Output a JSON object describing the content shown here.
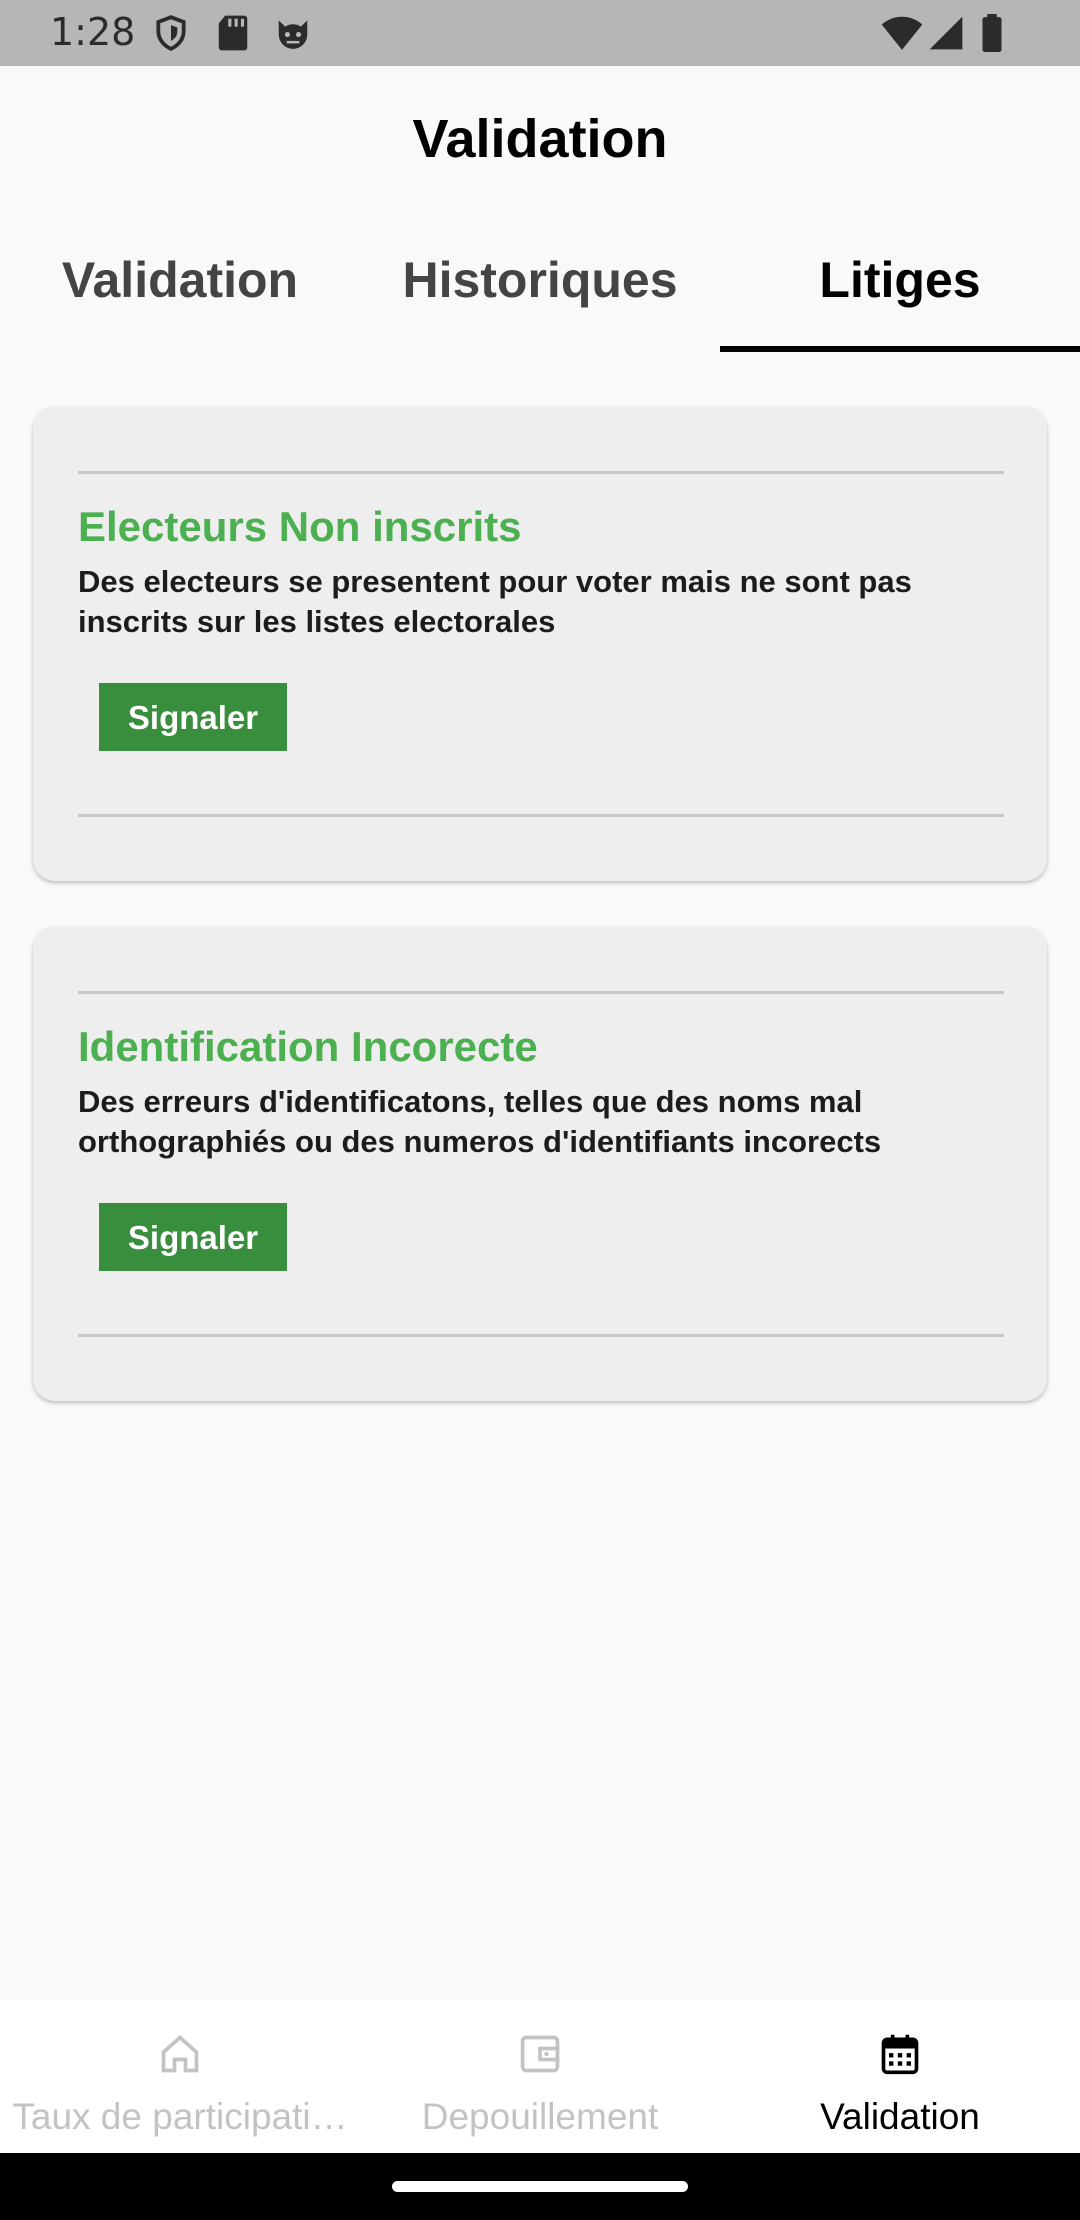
{
  "status_bar": {
    "time": "1:28",
    "left_icons": [
      "shield-icon",
      "sd-card-icon",
      "cat-face-icon"
    ],
    "right_icons": [
      "wifi-icon",
      "signal-icon",
      "battery-icon"
    ]
  },
  "header": {
    "title": "Validation"
  },
  "tabs": [
    {
      "label": "Validation",
      "active": false
    },
    {
      "label": "Historiques",
      "active": false
    },
    {
      "label": "Litiges",
      "active": true
    }
  ],
  "cards": [
    {
      "title": "Electeurs Non inscrits",
      "description": "Des electeurs se presentent pour voter mais ne sont pas inscrits sur les listes electorales",
      "button_label": "Signaler"
    },
    {
      "title": "Identification Incorecte",
      "description": "Des erreurs d'identificatons, telles que des noms mal orthographiés ou des numeros d'identifiants incorects",
      "button_label": "Signaler"
    }
  ],
  "bottom_nav": [
    {
      "label": "Taux de participati…",
      "icon": "home-icon",
      "active": false
    },
    {
      "label": "Depouillement",
      "icon": "wallet-icon",
      "active": false
    },
    {
      "label": "Validation",
      "icon": "calendar-icon",
      "active": true
    }
  ],
  "colors": {
    "accent_green": "#4caf50",
    "button_green": "#388e3c",
    "active_tab": "#000000",
    "inactive_nav": "#c3c3c3"
  }
}
